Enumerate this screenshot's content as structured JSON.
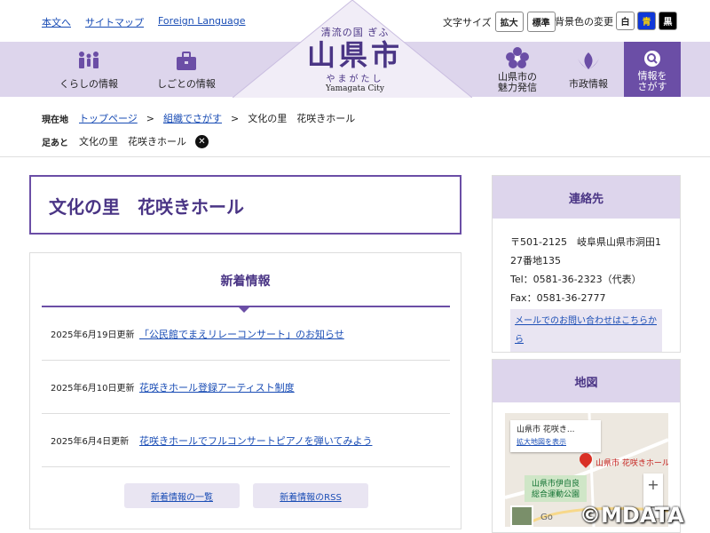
{
  "top": {
    "links": [
      "本文へ",
      "サイトマップ",
      "Foreign Language"
    ],
    "fontsize_label": "文字サイズ",
    "fontsize_buttons": [
      "拡大",
      "標準"
    ],
    "bg_label": "背景色の変更",
    "bg_buttons": [
      "白",
      "青",
      "黒"
    ]
  },
  "logo": {
    "tagline": "清流の国 ぎふ",
    "name": "山県市",
    "kana": "やまがたし",
    "en": "Yamagata City"
  },
  "nav": {
    "items": [
      "くらしの情報",
      "しごとの情報",
      "山県市の魅力発信",
      "市政情報"
    ],
    "miryoku_line1": "山県市の",
    "miryoku_line2": "魅力発信",
    "search_line1": "情報を",
    "search_line2": "さがす"
  },
  "breadcrumb": {
    "current_label": "現在地",
    "items": [
      "トップページ",
      "組織でさがす",
      "文化の里　花咲きホール"
    ],
    "sep": ">",
    "footprint_label": "足あと",
    "footprint_item": "文化の里　花咲きホール"
  },
  "page": {
    "title": "文化の里　花咲きホール"
  },
  "news": {
    "title": "新着情報",
    "items": [
      {
        "date": "2025年6月19日更新",
        "text": "「公民館でまえリレーコンサート」のお知らせ"
      },
      {
        "date": "2025年6月10日更新",
        "text": "花咲きホール登録アーティスト制度"
      },
      {
        "date": "2025年6月4日更新",
        "text": "花咲きホールでフルコンサートピアノを弾いてみよう"
      }
    ],
    "list_button": "新着情報の一覧",
    "rss_button": "新着情報のRSS"
  },
  "contact": {
    "title": "連絡先",
    "address1": "〒501-2125　岐阜県山県市洞田1",
    "address2": "27番地135",
    "tel": "Tel：0581-36-2323（代表）",
    "fax": "Fax：0581-36-2777",
    "mail": "メールでのお問い合わせはこちらから"
  },
  "map": {
    "title": "地図",
    "card_title": "山県市 花咲き...",
    "card_link": "拡大地図を表示",
    "pin_label": "山県市 花咲きホール",
    "park_line1": "山県市伊自良",
    "park_line2": "総合運動公園",
    "zoom_in": "+",
    "zoom_out": "−",
    "google": "Go"
  },
  "watermark": "©MDATA",
  "colors": {
    "accent": "#6b4ea6",
    "band": "#ddd5ec",
    "link": "#1a4db5"
  }
}
